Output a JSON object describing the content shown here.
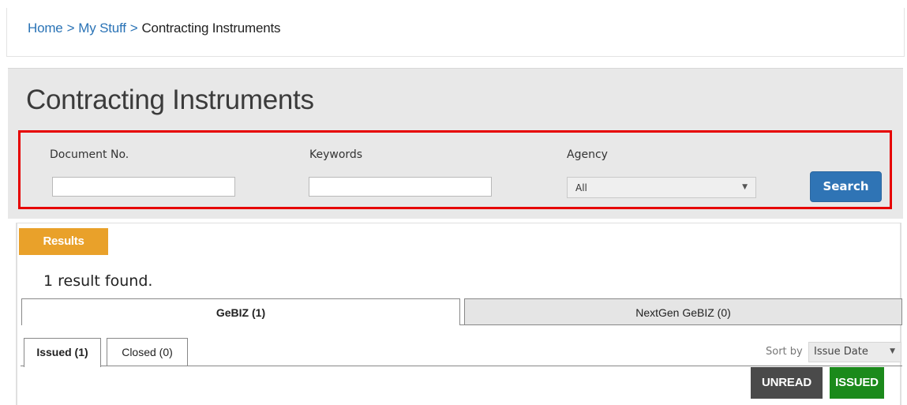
{
  "breadcrumb": {
    "home": "Home",
    "sep1": ">",
    "my_stuff": "My Stuff",
    "sep2": ">",
    "current": "Contracting Instruments"
  },
  "page": {
    "title": "Contracting Instruments"
  },
  "search": {
    "document_no_label": "Document No.",
    "document_no_value": "",
    "keywords_label": "Keywords",
    "keywords_value": "",
    "agency_label": "Agency",
    "agency_value": "All",
    "search_button": "Search"
  },
  "results": {
    "tag": "Results",
    "count_text": "1 result found.",
    "main_tabs": [
      {
        "label": "GeBIZ (1)",
        "active": true
      },
      {
        "label": "NextGen GeBIZ (0)",
        "active": false
      }
    ],
    "sub_tabs": [
      {
        "label": "Issued (1)",
        "active": true
      },
      {
        "label": "Closed (0)",
        "active": false
      }
    ],
    "sort_label": "Sort by",
    "sort_value": "Issue Date",
    "badges": {
      "unread": "UNREAD",
      "issued": "ISSUED"
    }
  },
  "colors": {
    "link": "#2a73b6",
    "search_button": "#2f74b5",
    "results_tag": "#e9a12a",
    "highlight_border": "#e60000",
    "unread_badge": "#4a4a4a",
    "issued_badge": "#1b8a1b"
  }
}
